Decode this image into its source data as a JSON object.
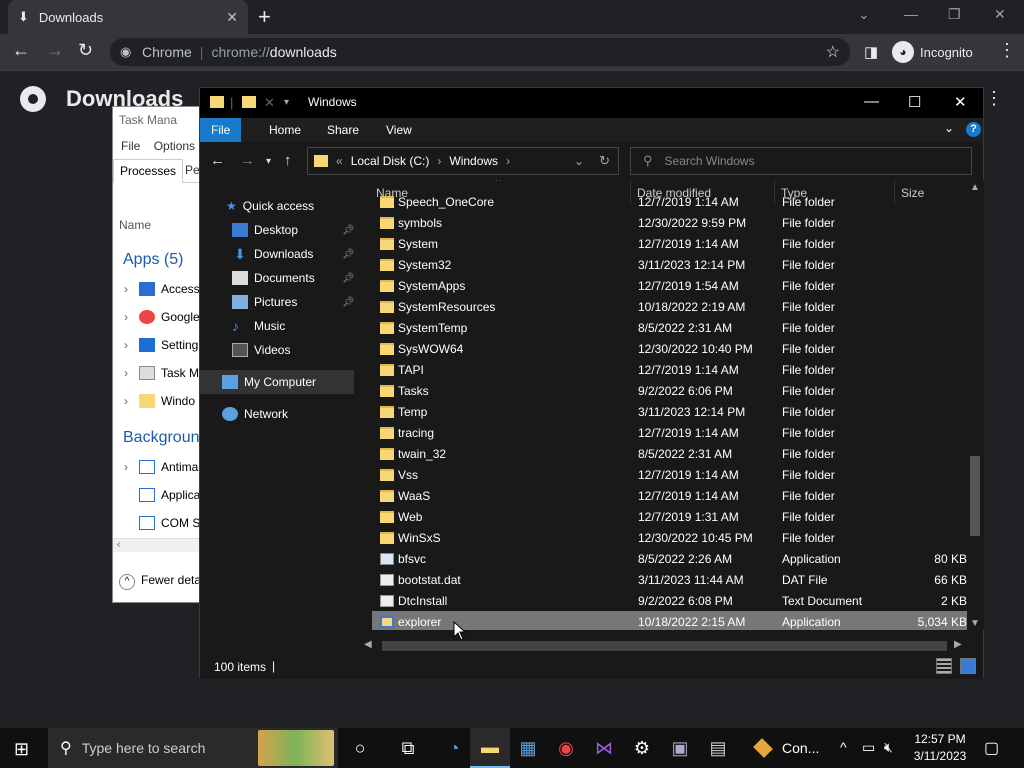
{
  "chrome": {
    "tab_title": "Downloads",
    "omnibox": {
      "site": "Chrome",
      "url_prefix": "chrome://",
      "url_path": "downloads"
    },
    "profile_label": "Incognito",
    "page_title": "Downloads"
  },
  "task_manager": {
    "title": "Task Mana",
    "menu": [
      "File",
      "Options"
    ],
    "tabs": [
      "Processes",
      "Per"
    ],
    "name_header": "Name",
    "apps_group": "Apps (5)",
    "apps": [
      "Access",
      "Google",
      "Setting",
      "Task M",
      "Windo"
    ],
    "background_group": "Backgroun",
    "background": [
      "Antima",
      "Applica",
      "COM S"
    ],
    "fewer_details": "Fewer deta"
  },
  "explorer": {
    "title": "Windows",
    "ribbon_tabs": [
      "File",
      "Home",
      "Share",
      "View"
    ],
    "address": {
      "root": "Local Disk (C:)",
      "folder": "Windows"
    },
    "search_placeholder": "Search Windows",
    "nav": {
      "quick_access": "Quick access",
      "desktop": "Desktop",
      "downloads": "Downloads",
      "documents": "Documents",
      "pictures": "Pictures",
      "music": "Music",
      "videos": "Videos",
      "my_computer": "My Computer",
      "network": "Network"
    },
    "columns": {
      "name": "Name",
      "date": "Date modified",
      "type": "Type",
      "size": "Size"
    },
    "rows": [
      {
        "name": "Speech_OneCore",
        "date": "12/7/2019 1:14 AM",
        "type": "File folder",
        "size": "",
        "icon": "folder"
      },
      {
        "name": "symbols",
        "date": "12/30/2022 9:59 PM",
        "type": "File folder",
        "size": "",
        "icon": "folder"
      },
      {
        "name": "System",
        "date": "12/7/2019 1:14 AM",
        "type": "File folder",
        "size": "",
        "icon": "folder"
      },
      {
        "name": "System32",
        "date": "3/11/2023 12:14 PM",
        "type": "File folder",
        "size": "",
        "icon": "folder"
      },
      {
        "name": "SystemApps",
        "date": "12/7/2019 1:54 AM",
        "type": "File folder",
        "size": "",
        "icon": "folder"
      },
      {
        "name": "SystemResources",
        "date": "10/18/2022 2:19 AM",
        "type": "File folder",
        "size": "",
        "icon": "folder"
      },
      {
        "name": "SystemTemp",
        "date": "8/5/2022 2:31 AM",
        "type": "File folder",
        "size": "",
        "icon": "folder"
      },
      {
        "name": "SysWOW64",
        "date": "12/30/2022 10:40 PM",
        "type": "File folder",
        "size": "",
        "icon": "folder"
      },
      {
        "name": "TAPI",
        "date": "12/7/2019 1:14 AM",
        "type": "File folder",
        "size": "",
        "icon": "folder"
      },
      {
        "name": "Tasks",
        "date": "9/2/2022 6:06 PM",
        "type": "File folder",
        "size": "",
        "icon": "folder"
      },
      {
        "name": "Temp",
        "date": "3/11/2023 12:14 PM",
        "type": "File folder",
        "size": "",
        "icon": "folder"
      },
      {
        "name": "tracing",
        "date": "12/7/2019 1:14 AM",
        "type": "File folder",
        "size": "",
        "icon": "folder"
      },
      {
        "name": "twain_32",
        "date": "8/5/2022 2:31 AM",
        "type": "File folder",
        "size": "",
        "icon": "folder"
      },
      {
        "name": "Vss",
        "date": "12/7/2019 1:14 AM",
        "type": "File folder",
        "size": "",
        "icon": "folder"
      },
      {
        "name": "WaaS",
        "date": "12/7/2019 1:14 AM",
        "type": "File folder",
        "size": "",
        "icon": "folder"
      },
      {
        "name": "Web",
        "date": "12/7/2019 1:31 AM",
        "type": "File folder",
        "size": "",
        "icon": "folder"
      },
      {
        "name": "WinSxS",
        "date": "12/30/2022 10:45 PM",
        "type": "File folder",
        "size": "",
        "icon": "folder"
      },
      {
        "name": "bfsvc",
        "date": "8/5/2022 2:26 AM",
        "type": "Application",
        "size": "80 KB",
        "icon": "app"
      },
      {
        "name": "bootstat.dat",
        "date": "3/11/2023 11:44 AM",
        "type": "DAT File",
        "size": "66 KB",
        "icon": "file"
      },
      {
        "name": "DtcInstall",
        "date": "9/2/2022 6:08 PM",
        "type": "Text Document",
        "size": "2 KB",
        "icon": "file"
      },
      {
        "name": "explorer",
        "date": "10/18/2022 2:15 AM",
        "type": "Application",
        "size": "5,034 KB",
        "icon": "explorer",
        "selected": true
      }
    ],
    "status_count": "100 items"
  },
  "taskbar": {
    "search_placeholder": "Type here to search",
    "con_label": "Con...",
    "time": "12:57 PM",
    "date": "3/11/2023"
  }
}
